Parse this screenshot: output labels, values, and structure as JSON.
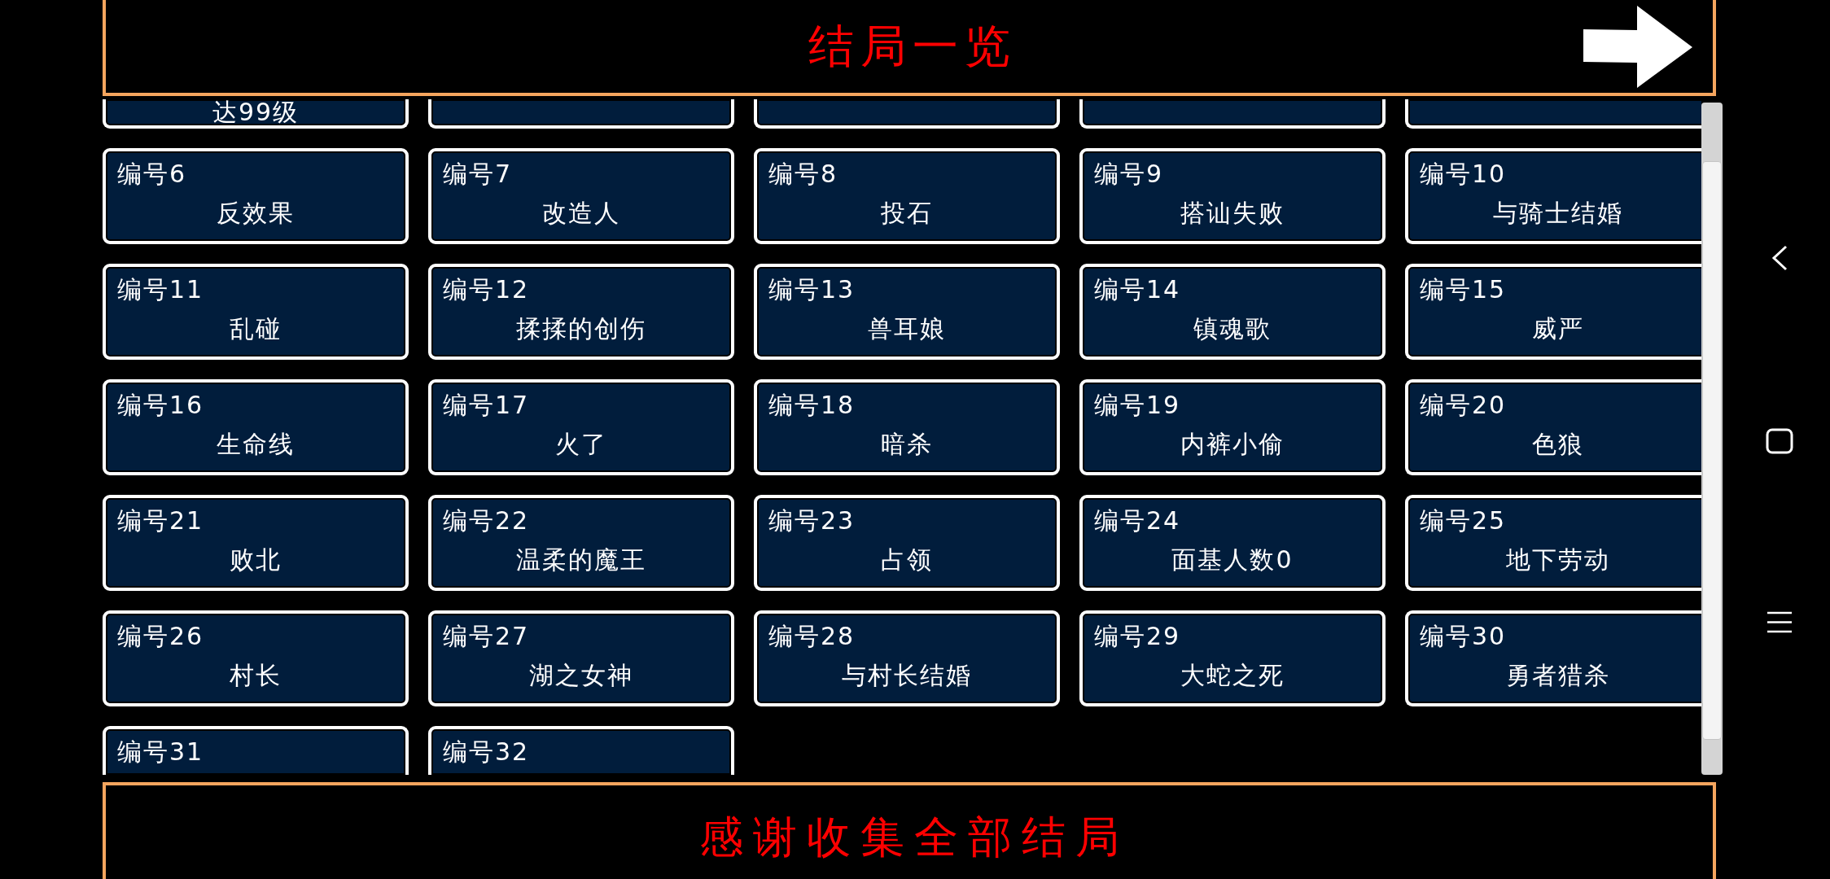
{
  "header": {
    "title": "结局一览"
  },
  "endings": [
    {
      "kind": "cut_top",
      "name": "达99级"
    },
    {
      "kind": "cut_top"
    },
    {
      "kind": "cut_top"
    },
    {
      "kind": "cut_top"
    },
    {
      "kind": "cut_top"
    },
    {
      "kind": "full",
      "number": "编号6",
      "name": "反效果"
    },
    {
      "kind": "full",
      "number": "编号7",
      "name": "改造人"
    },
    {
      "kind": "full",
      "number": "编号8",
      "name": "投石"
    },
    {
      "kind": "full",
      "number": "编号9",
      "name": "搭讪失败"
    },
    {
      "kind": "full",
      "number": "编号10",
      "name": "与骑士结婚"
    },
    {
      "kind": "full",
      "number": "编号11",
      "name": "乱碰"
    },
    {
      "kind": "full",
      "number": "编号12",
      "name": "揉揉的创伤"
    },
    {
      "kind": "full",
      "number": "编号13",
      "name": "兽耳娘"
    },
    {
      "kind": "full",
      "number": "编号14",
      "name": "镇魂歌"
    },
    {
      "kind": "full",
      "number": "编号15",
      "name": "威严"
    },
    {
      "kind": "full",
      "number": "编号16",
      "name": "生命线"
    },
    {
      "kind": "full",
      "number": "编号17",
      "name": "火了"
    },
    {
      "kind": "full",
      "number": "编号18",
      "name": "暗杀"
    },
    {
      "kind": "full",
      "number": "编号19",
      "name": "内裤小偷"
    },
    {
      "kind": "full",
      "number": "编号20",
      "name": "色狼"
    },
    {
      "kind": "full",
      "number": "编号21",
      "name": "败北"
    },
    {
      "kind": "full",
      "number": "编号22",
      "name": "温柔的魔王"
    },
    {
      "kind": "full",
      "number": "编号23",
      "name": "占领"
    },
    {
      "kind": "full",
      "number": "编号24",
      "name": "面基人数0"
    },
    {
      "kind": "full",
      "number": "编号25",
      "name": "地下劳动"
    },
    {
      "kind": "full",
      "number": "编号26",
      "name": "村长"
    },
    {
      "kind": "full",
      "number": "编号27",
      "name": "湖之女神"
    },
    {
      "kind": "full",
      "number": "编号28",
      "name": "与村长结婚"
    },
    {
      "kind": "full",
      "number": "编号29",
      "name": "大蛇之死"
    },
    {
      "kind": "full",
      "number": "编号30",
      "name": "勇者猎杀"
    },
    {
      "kind": "cut_bottom",
      "number": "编号31"
    },
    {
      "kind": "cut_bottom",
      "number": "编号32"
    }
  ],
  "footer": {
    "message": "感谢收集全部结局"
  }
}
